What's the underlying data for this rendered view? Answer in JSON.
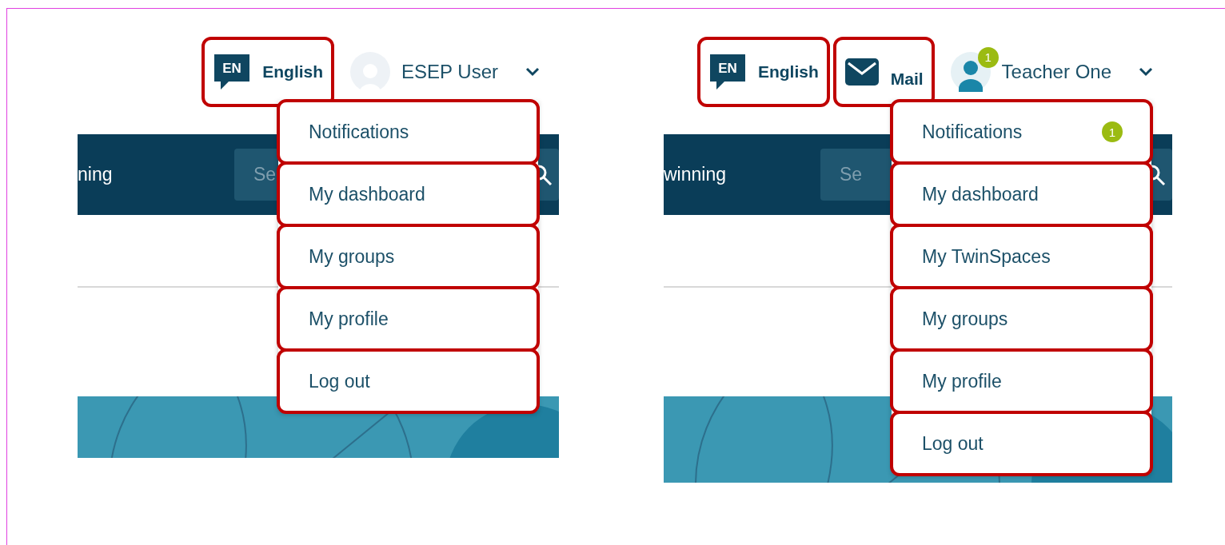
{
  "panels": [
    {
      "header_items": [
        {
          "kind": "language",
          "code": "EN",
          "label": "English",
          "highlighted": true
        }
      ],
      "user": {
        "kind": "guest",
        "name": "ESEP User",
        "highlighted": false
      },
      "nav": {
        "text": "ning",
        "search_placeholder": "Se"
      },
      "menu": [
        {
          "label": "Notifications",
          "highlighted": true
        },
        {
          "label": "My dashboard",
          "highlighted": true
        },
        {
          "label": "My groups",
          "highlighted": true
        },
        {
          "label": "My profile",
          "highlighted": true
        },
        {
          "label": "Log out",
          "highlighted": true
        }
      ]
    },
    {
      "header_items": [
        {
          "kind": "language",
          "code": "EN",
          "label": "English",
          "highlighted": true
        },
        {
          "kind": "mail",
          "label": "Mail",
          "highlighted": true
        }
      ],
      "user": {
        "kind": "member",
        "badge": "1",
        "name": "Teacher One",
        "highlighted": false
      },
      "nav": {
        "text": "winning",
        "search_placeholder": "Se"
      },
      "menu": [
        {
          "label": "Notifications",
          "badge": "1",
          "highlighted": true
        },
        {
          "label": "My dashboard",
          "highlighted": true
        },
        {
          "label": "My TwinSpaces",
          "highlighted": true
        },
        {
          "label": "My groups",
          "highlighted": true
        },
        {
          "label": "My profile",
          "highlighted": true
        },
        {
          "label": "Log out",
          "highlighted": true
        }
      ]
    }
  ]
}
